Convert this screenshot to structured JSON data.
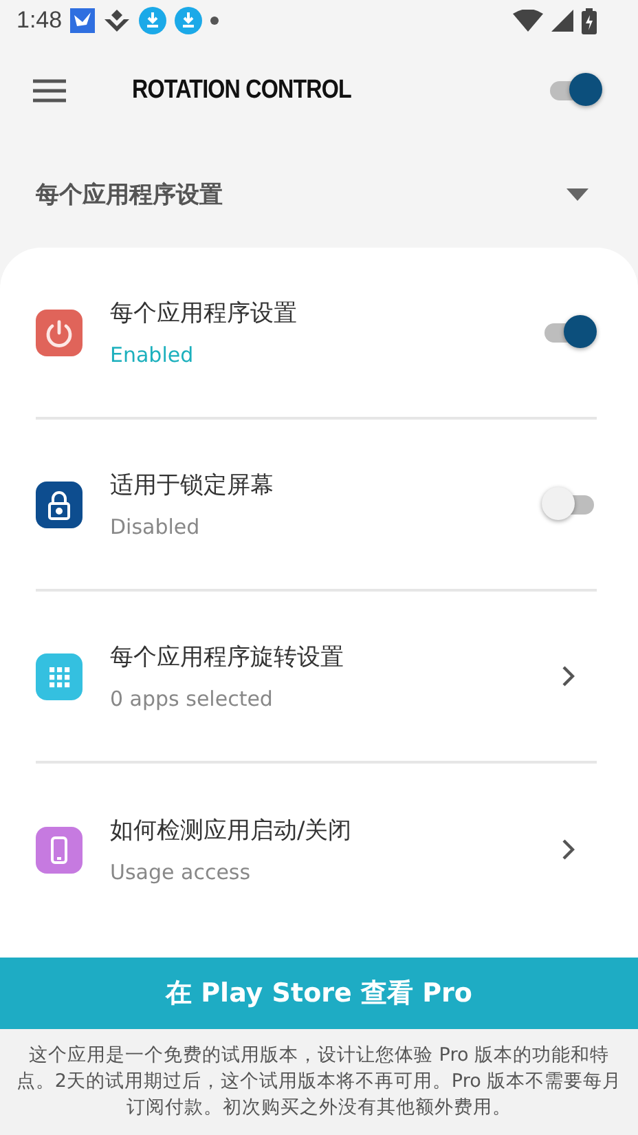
{
  "status_bar": {
    "time": "1:48"
  },
  "app_bar": {
    "title": "ROTATION CONTROL",
    "master_switch": {
      "on": true
    }
  },
  "section": {
    "title": "每个应用程序设置",
    "expanded": true
  },
  "settings": [
    {
      "kind": "switch",
      "title": "每个应用程序设置",
      "subtitle": "Enabled",
      "on": true,
      "color": "#e0645a"
    },
    {
      "kind": "switch",
      "title": "适用于锁定屏幕",
      "subtitle": "Disabled",
      "on": false,
      "color": "#0d4d8f"
    },
    {
      "kind": "link",
      "title": "每个应用程序旋转设置",
      "subtitle": "0 apps selected",
      "color": "#34c0e0"
    },
    {
      "kind": "link",
      "title": "如何检测应用启动/关闭",
      "subtitle": "Usage access",
      "color": "#c67ae0"
    }
  ],
  "pro_button": "在 Play Store 查看 Pro",
  "footer_note": "这个应用是一个免费的试用版本，设计让您体验 Pro 版本的功能和特点。2天的试用期过后，这个试用版本将不再可用。Pro 版本不需要每月订阅付款。初次购买之外没有其他额外费用。"
}
